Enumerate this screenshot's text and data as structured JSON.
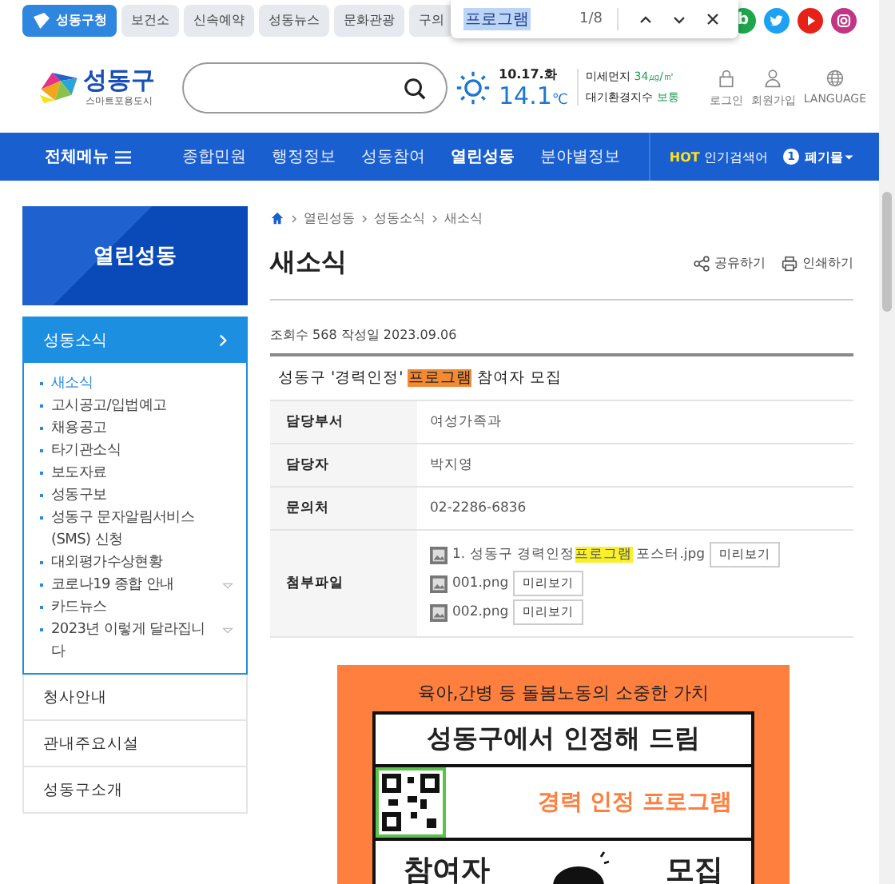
{
  "top_tabs": [
    {
      "label": "성동구청",
      "selected": true
    },
    {
      "label": "보건소",
      "selected": false
    },
    {
      "label": "신속예약",
      "selected": false
    },
    {
      "label": "성동뉴스",
      "selected": false
    },
    {
      "label": "문화관광",
      "selected": false
    },
    {
      "label": "구의",
      "selected": false
    }
  ],
  "social": [
    {
      "kind": "blog",
      "label": "b",
      "color": "#1ea64b"
    },
    {
      "kind": "twitter",
      "color": "#1da1f2"
    },
    {
      "kind": "youtube",
      "color": "#e62117"
    },
    {
      "kind": "instagram",
      "color": "#c13584"
    }
  ],
  "find_bar": {
    "query": "프로그램",
    "count": "1/8"
  },
  "logo": {
    "name": "성동구",
    "tagline": "스마트포용도시"
  },
  "weather": {
    "date": "10.17.화",
    "temp": "14.1",
    "unit": "℃",
    "dust_label": "미세먼지",
    "dust_value": "34㎍/㎥",
    "air_label": "대기환경지수",
    "air_value": "보통"
  },
  "user_links": [
    {
      "kind": "lock",
      "label": "로그인"
    },
    {
      "kind": "person",
      "label": "회원가입"
    },
    {
      "kind": "globe",
      "label": "LANGUAGE"
    }
  ],
  "nav": {
    "all_menu": "전체메뉴",
    "items": [
      {
        "label": "종합민원",
        "selected": false
      },
      {
        "label": "행정정보",
        "selected": false
      },
      {
        "label": "성동참여",
        "selected": false
      },
      {
        "label": "열린성동",
        "selected": true
      },
      {
        "label": "분야별정보",
        "selected": false
      }
    ],
    "hot": "HOT",
    "hot_label": "인기검색어",
    "hot_rank": "1",
    "hot_term": "폐기물"
  },
  "sidebar": {
    "title": "열린성동",
    "sections": [
      {
        "label": "성동소식",
        "expanded": true,
        "children": [
          {
            "label": "새소식",
            "selected": true,
            "has_sub": false
          },
          {
            "label": "고시공고/입법예고",
            "selected": false,
            "has_sub": false
          },
          {
            "label": "채용공고",
            "selected": false,
            "has_sub": false
          },
          {
            "label": "타기관소식",
            "selected": false,
            "has_sub": false
          },
          {
            "label": "보도자료",
            "selected": false,
            "has_sub": false
          },
          {
            "label": "성동구보",
            "selected": false,
            "has_sub": false
          },
          {
            "label": "성동구 문자알림서비스(SMS) 신청",
            "selected": false,
            "has_sub": false
          },
          {
            "label": "대외평가수상현황",
            "selected": false,
            "has_sub": false
          },
          {
            "label": "코로나19 종합 안내",
            "selected": false,
            "has_sub": true
          },
          {
            "label": "카드뉴스",
            "selected": false,
            "has_sub": false
          },
          {
            "label": "2023년 이렇게 달라집니다",
            "selected": false,
            "has_sub": true
          }
        ]
      },
      {
        "label": "청사안내",
        "expanded": false
      },
      {
        "label": "관내주요시설",
        "expanded": false
      },
      {
        "label": "성동구소개",
        "expanded": false
      }
    ]
  },
  "breadcrumb": [
    "열린성동",
    "성동소식",
    "새소식"
  ],
  "page_title": "새소식",
  "actions": [
    {
      "kind": "share",
      "label": "공유하기"
    },
    {
      "kind": "print",
      "label": "인쇄하기"
    }
  ],
  "meta": "조회수 568 작성일 2023.09.06",
  "post_title": [
    {
      "text": "성동구 '경력인정' ",
      "highlighted": false
    },
    {
      "text": "프로그램",
      "highlighted": true
    },
    {
      "text": " 참여자 모집",
      "highlighted": false
    }
  ],
  "fields": [
    {
      "label": "담당부서",
      "value": "여성가족과"
    },
    {
      "label": "담당자",
      "value": "박지영"
    },
    {
      "label": "문의처",
      "value": "02-2286-6836"
    }
  ],
  "attachments_label": "첨부파일",
  "attachments": [
    {
      "name": [
        {
          "text": "1. 성동구 경력인정",
          "highlighted": false
        },
        {
          "text": "프로그램",
          "highlighted": true
        },
        {
          "text": " 포스터.jpg",
          "highlighted": false
        }
      ],
      "button": "미리보기"
    },
    {
      "name": [
        {
          "text": "001.png",
          "highlighted": false
        }
      ],
      "button": "미리보기"
    },
    {
      "name": [
        {
          "text": "002.png",
          "highlighted": false
        }
      ],
      "button": "미리보기"
    }
  ],
  "poster": {
    "tagline": "육아,간병 등 돌봄노동의 소중한 가치",
    "headline": "성동구에서 인정해 드림",
    "program": "경력 인정 프로그램",
    "bottom_left": "참여자",
    "bottom_right": "모집"
  }
}
